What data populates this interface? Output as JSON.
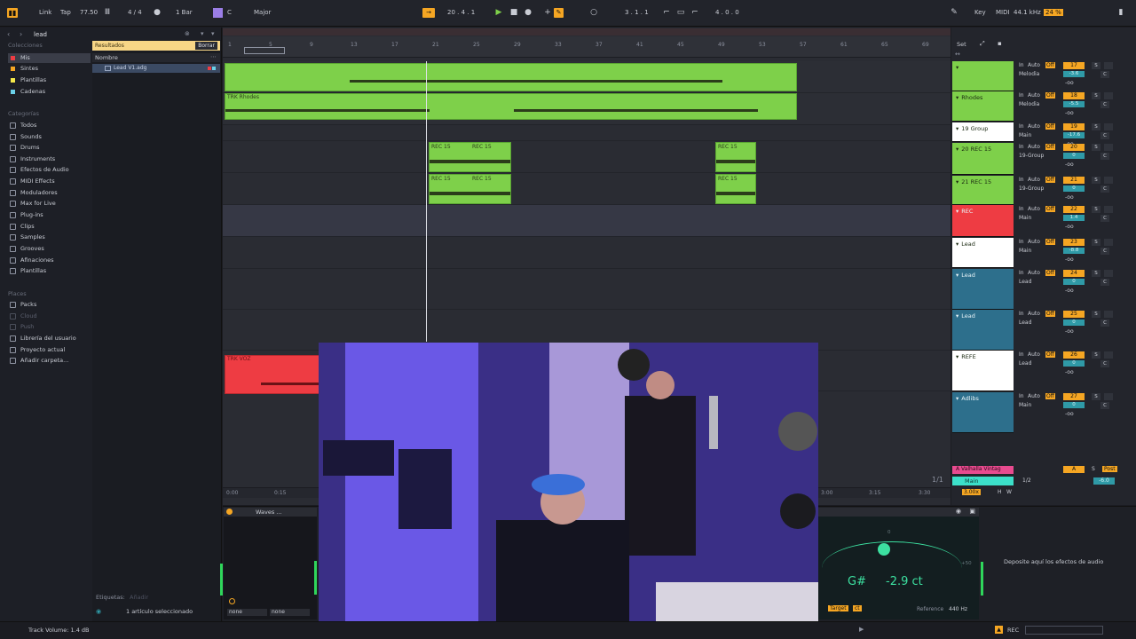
{
  "transport": {
    "link": "Link",
    "tap": "Tap",
    "tempo": "77.50",
    "signature": "4 / 4",
    "quantize": "1 Bar",
    "key": "C",
    "scale": "Major",
    "position": "20 .  4 .  1",
    "loop_start": "3 .  1 .  1",
    "loop_length": "4 .  0 .  0",
    "key_label": "Key",
    "midi_label": "MIDI",
    "sample_rate": "44.1 kHz",
    "cpu": "24 %"
  },
  "browser": {
    "search_value": "lead",
    "collections_title": "Colecciones",
    "collections": [
      {
        "label": "Mis",
        "color": "#ee3c43"
      },
      {
        "label": "Sintes",
        "color": "#f5a623"
      },
      {
        "label": "Plantillas",
        "color": "#f5e94a"
      },
      {
        "label": "Cadenas",
        "color": "#6ad0e8"
      }
    ],
    "categories_title": "Categorías",
    "categories": [
      "Todos",
      "Sounds",
      "Drums",
      "Instruments",
      "Efectos de Audio",
      "MIDI Effects",
      "Moduladores",
      "Max for Live",
      "Plug-ins",
      "Clips",
      "Samples",
      "Grooves",
      "Afinaciones",
      "Plantillas"
    ],
    "places_title": "Places",
    "places": [
      "Packs",
      "Cloud",
      "Push",
      "Librería del usuario",
      "Proyecto actual",
      "Añadir carpeta..."
    ],
    "results_label": "Resultados",
    "clear_label": "Borrar",
    "name_header": "Nombre",
    "result_item": "Lead V1.adg",
    "tags_label": "Etiquetas:",
    "tags_add": "Añadir",
    "selected_info": "1 artículo seleccionado"
  },
  "ruler": {
    "bars": [
      "1",
      "5",
      "9",
      "13",
      "17",
      "21",
      "25",
      "29",
      "33",
      "37",
      "41",
      "45",
      "49",
      "53",
      "57",
      "61",
      "65",
      "69"
    ],
    "bottom_times": [
      "0:00",
      "0:15",
      "3:00",
      "3:15",
      "3:30"
    ]
  },
  "clips": {
    "trk_rhodes": "TRK Rhodes",
    "rec15": "REC 15",
    "trk_vo": "TRK VOZ"
  },
  "mixer": {
    "set_label": "Set",
    "tracks": [
      {
        "name": "",
        "routing": "Melodia",
        "num": "17",
        "vol": "-3.6",
        "color": "#7ed04a"
      },
      {
        "name": "Rhodes",
        "routing": "Melodia",
        "num": "18",
        "vol": "-5.5",
        "color": "#7ed04a"
      },
      {
        "name": "19 Group",
        "routing": "Main",
        "num": "19",
        "vol": "-17.6",
        "color": "#ffffff"
      },
      {
        "name": "20 REC 15",
        "routing": "19-Group",
        "num": "20",
        "vol": "0",
        "color": "#7ed04a"
      },
      {
        "name": "21 REC 15",
        "routing": "19-Group",
        "num": "21",
        "vol": "0",
        "color": "#7ed04a"
      },
      {
        "name": "REC",
        "routing": "Main",
        "num": "22",
        "vol": "1.4",
        "color": "#ee3c43"
      },
      {
        "name": "Lead",
        "routing": "Main",
        "num": "23",
        "vol": "-8.8",
        "color": "#ffffff"
      },
      {
        "name": "Lead",
        "routing": "Lead",
        "num": "24",
        "vol": "0",
        "color": "#2d6f8c"
      },
      {
        "name": "Lead",
        "routing": "Lead",
        "num": "25",
        "vol": "0",
        "color": "#2d6f8c"
      },
      {
        "name": "REFE",
        "routing": "Lead",
        "num": "26",
        "vol": "0",
        "color": "#ffffff"
      },
      {
        "name": "Adlibs",
        "routing": "Main",
        "num": "27",
        "vol": "0",
        "color": "#2d6f8c"
      }
    ],
    "return_track": "A Valhalla Vintag",
    "main_track": "Main",
    "main_ratio": "1/2",
    "main_db": "-6.0",
    "page_info": "1/1",
    "zoom_value": "3.00x",
    "in_label": "In",
    "auto_label": "Auto",
    "off_label": "Off",
    "s_label": "S",
    "c_label": "C",
    "inf_label": "-oo",
    "a_label": "A",
    "post_label": "Post",
    "h_label": "H",
    "w_label": "W"
  },
  "devices": {
    "waves_title": "Waves ...",
    "none1": "none",
    "none2": "none",
    "tuner_note": "G#",
    "tuner_cents": "-2.9 ct",
    "tuner_zero": "0",
    "tuner_plus": "+50",
    "target_label": "Target",
    "ct_label": "ct",
    "reference_label": "Reference",
    "reference_value": "440 Hz",
    "drop_hint": "Deposite aquí los efectos de audio"
  },
  "status": {
    "track_volume": "Track Volume: 1.4 dB",
    "rec_label": "REC"
  }
}
